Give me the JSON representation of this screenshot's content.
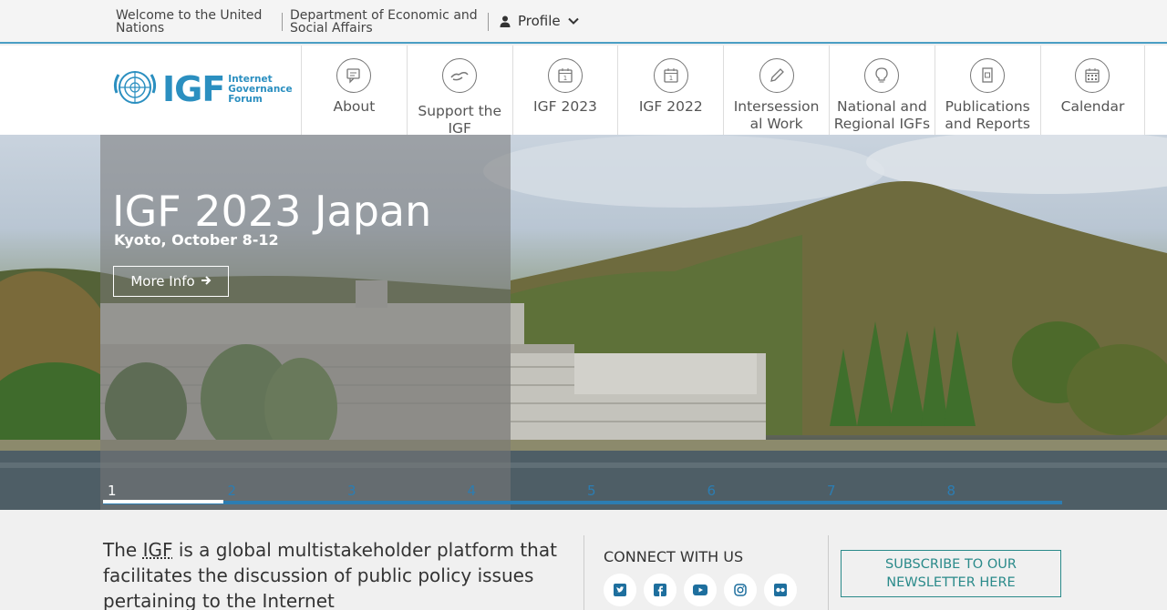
{
  "topbar": {
    "welcome": "Welcome to the United Nations",
    "desa": "Department of Economic and Social Affairs",
    "profile": "Profile"
  },
  "logo": {
    "main": "IGF",
    "sub_line1": "Internet",
    "sub_line2": "Governance",
    "sub_line3": "Forum"
  },
  "nav": {
    "items": [
      {
        "label": "About",
        "icon": "chat-icon"
      },
      {
        "label": "Support the IGF",
        "icon": "handshake-icon"
      },
      {
        "label": "IGF 2023",
        "icon": "calendar-1-icon"
      },
      {
        "label": "IGF 2022",
        "icon": "calendar-1-icon"
      },
      {
        "label": "Intersessional Work",
        "icon": "pencil-icon"
      },
      {
        "label": "National and Regional IGFs",
        "icon": "lightbulb-icon"
      },
      {
        "label": "Publications and Reports",
        "icon": "document-icon"
      },
      {
        "label": "Calendar",
        "icon": "calendar-grid-icon"
      }
    ]
  },
  "hero": {
    "title": "IGF 2023 Japan",
    "subtitle": "Kyoto, October 8-12",
    "button": "More Info",
    "slides": [
      "1",
      "2",
      "3",
      "4",
      "5",
      "6",
      "7",
      "8"
    ],
    "active_slide": 1
  },
  "bottom": {
    "about_pre": "The ",
    "about_abbr": "IGF",
    "about_post": " is a global multistakeholder platform that facilitates the discussion of public policy issues pertaining to the Internet",
    "connect_title": "CONNECT WITH US",
    "social": [
      "twitter-icon",
      "facebook-icon",
      "youtube-icon",
      "instagram-icon",
      "flickr-icon"
    ],
    "subscribe": "SUBSCRIBE TO OUR NEWSLETTER HERE"
  },
  "colors": {
    "accent": "#2b8fc0",
    "slide_bar": "#2c7db2",
    "subscribe": "#2a8a8a"
  }
}
